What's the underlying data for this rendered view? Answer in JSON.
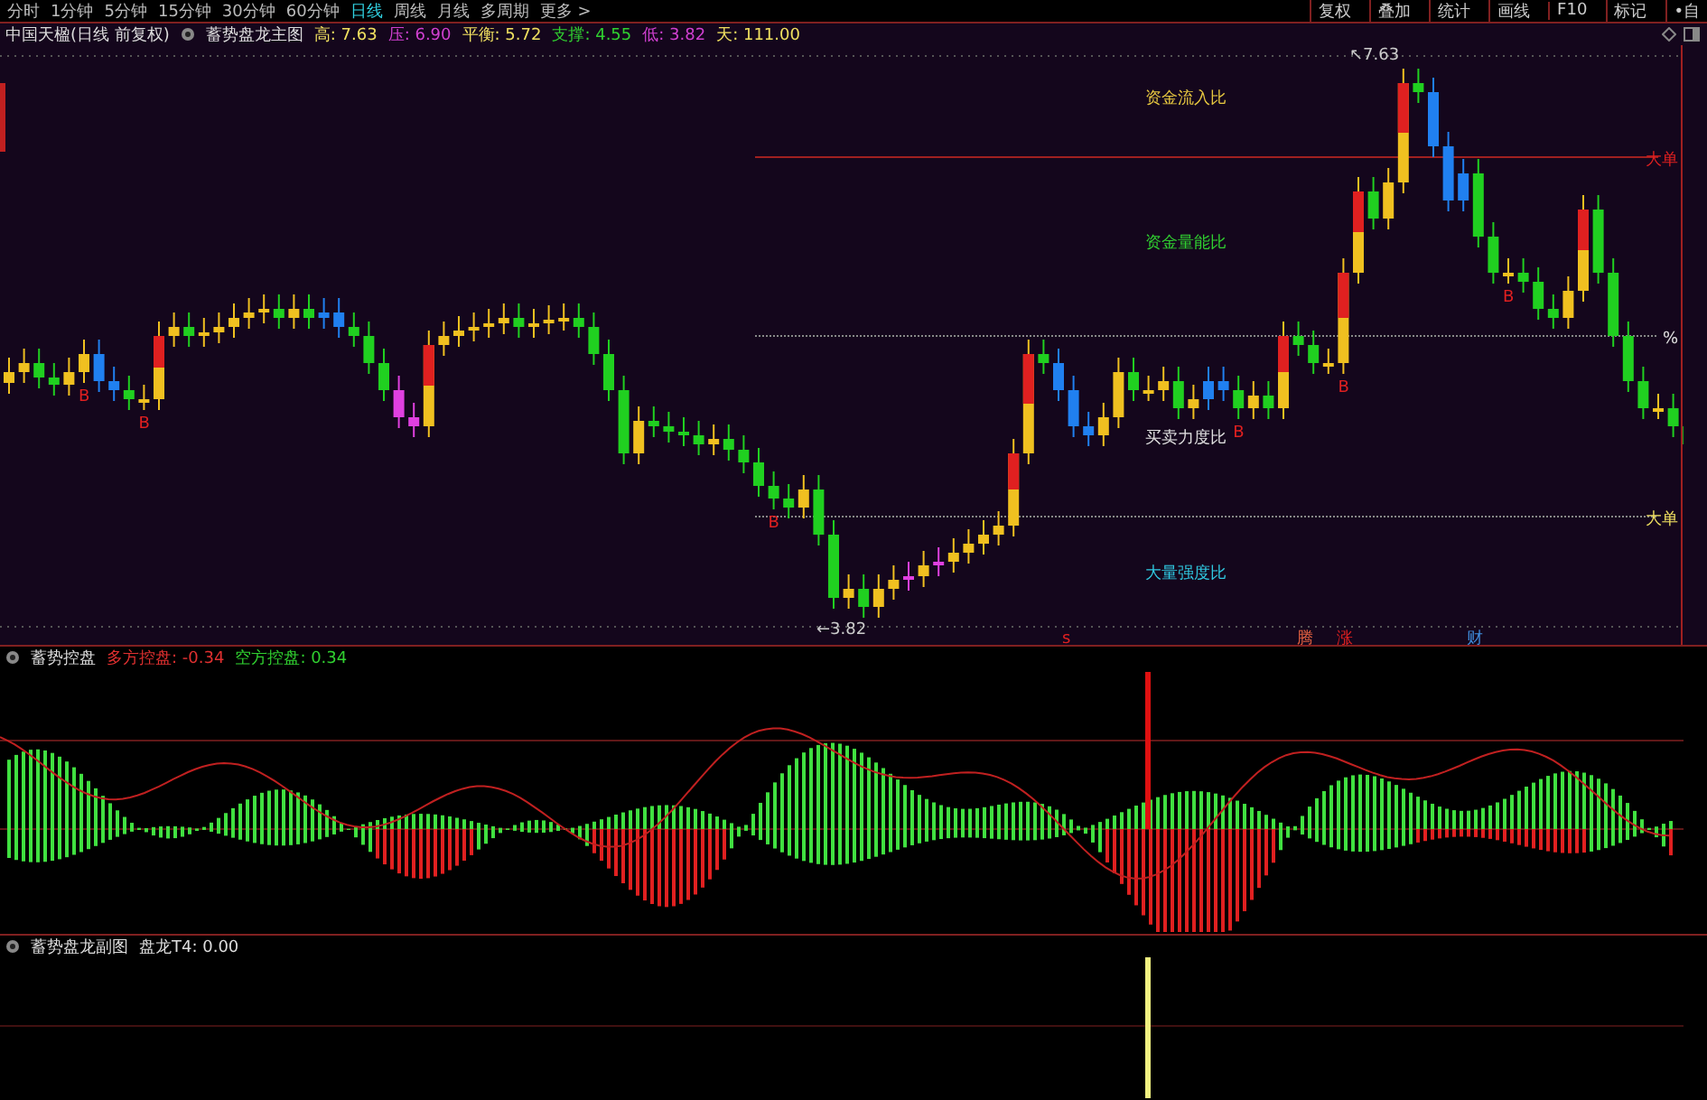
{
  "period_tabs": [
    {
      "label": "分时",
      "selected": false
    },
    {
      "label": "1分钟",
      "selected": false
    },
    {
      "label": "5分钟",
      "selected": false
    },
    {
      "label": "15分钟",
      "selected": false
    },
    {
      "label": "30分钟",
      "selected": false
    },
    {
      "label": "60分钟",
      "selected": false
    },
    {
      "label": "日线",
      "selected": true
    },
    {
      "label": "周线",
      "selected": false
    },
    {
      "label": "月线",
      "selected": false
    },
    {
      "label": "多周期",
      "selected": false
    },
    {
      "label": "更多 >",
      "selected": false
    }
  ],
  "tools": [
    "复权",
    "叠加",
    "统计",
    "画线",
    "F10",
    "标记",
    "•自"
  ],
  "main": {
    "title": "中国天楹(日线 前复权)",
    "indicator": "蓄势盘龙主图",
    "stats": [
      {
        "text": "高: 7.63",
        "color": "#f0e060"
      },
      {
        "text": "压: 6.90",
        "color": "#d040d0"
      },
      {
        "text": "平衡: 5.72",
        "color": "#f0e060"
      },
      {
        "text": "支撑: 4.55",
        "color": "#30d030"
      },
      {
        "text": "低: 3.82",
        "color": "#d040d0"
      },
      {
        "text": "天: 111.00",
        "color": "#f0e060"
      }
    ],
    "zones": [
      {
        "label": "资金流入比",
        "color": "#e8c840"
      },
      {
        "label": "资金量能比",
        "color": "#30d030"
      },
      {
        "label": "买卖力度比",
        "color": "#e0e0e0"
      },
      {
        "label": "大量强度比",
        "color": "#30c8e0"
      }
    ],
    "levels": [
      {
        "label": "大单",
        "color": "#e02020"
      },
      {
        "label": "%",
        "color": "#e0e0e0"
      },
      {
        "label": "大单",
        "color": "#f0e060"
      }
    ],
    "high_marker": "↖7.63",
    "low_marker": "←3.82",
    "buy_marks": [
      "B",
      "B",
      "B",
      "B",
      "B",
      "B"
    ],
    "event_flags": [
      {
        "label": "s",
        "color": "#e02020"
      },
      {
        "label": "腾",
        "color": "#e06040"
      },
      {
        "label": "涨",
        "color": "#e02020"
      },
      {
        "label": "财",
        "color": "#4090e0"
      }
    ]
  },
  "indicator": {
    "title": "蓄势控盘",
    "long": "多方控盘: -0.34",
    "short": "空方控盘: 0.34"
  },
  "sub": {
    "title": "蓄势盘龙副图",
    "reading": "盘龙T4: 0.00"
  }
}
